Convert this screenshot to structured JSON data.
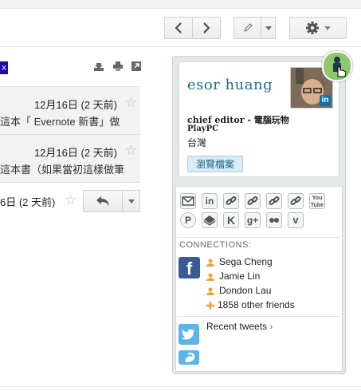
{
  "toolbar": {
    "prev_icon": "chevron-left-icon",
    "next_icon": "chevron-right-icon",
    "edit_icon": "pencil-icon",
    "settings_icon": "gear-icon"
  },
  "thread": {
    "label_tag": "x",
    "messages": [
      {
        "date": "12月16日 (2 天前)",
        "snippet": "這本「 Evernote 新書」做"
      },
      {
        "date": "12月16日 (2 天前)",
        "snippet": "這本書（如果當初這樣做筆"
      },
      {
        "date": "6日 (2 天前)",
        "snippet": ""
      }
    ]
  },
  "profile": {
    "name": "esor huang",
    "title_line1": "chief editor - 電腦玩物",
    "title_line2": "PlayPC",
    "location": "台灣",
    "view_profile_label": "瀏覽檔案",
    "linkedin_badge": "in"
  },
  "social_icons": [
    "mail-icon",
    "linkedin-icon",
    "link-icon",
    "link-icon",
    "link-icon",
    "link-icon",
    "youtube-icon",
    "pinterest-icon",
    "layers-icon",
    "klout-icon",
    "googleplus-icon",
    "flickr-icon",
    "vimeo-icon"
  ],
  "connections": {
    "label": "CONNECTIONS:",
    "facebook_letter": "f",
    "friends": [
      "Sega Cheng",
      "Jamie Lin",
      "Dondon Lau"
    ],
    "more": "1858 other friends"
  },
  "twitter": {
    "label": "Recent tweets",
    "chevron": "›"
  },
  "colors": {
    "name": "#1e6e8a",
    "facebook": "#3b5998",
    "twitter": "#5bb5e8",
    "person": "#f0a030"
  }
}
